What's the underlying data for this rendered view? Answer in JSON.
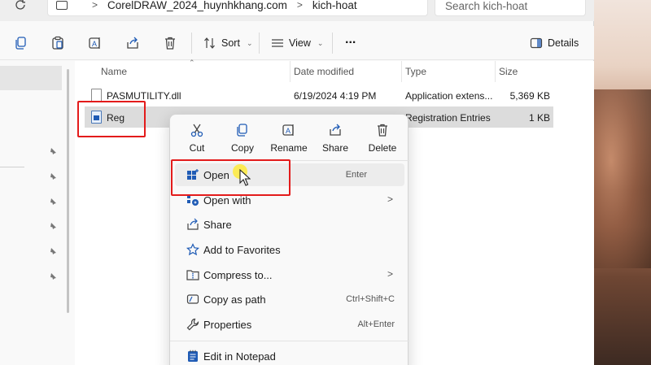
{
  "address": {
    "segments": [
      "CorelDRAW_2024_huynhkhang.com",
      "kich-hoat"
    ],
    "search_placeholder": "Search kich-hoat"
  },
  "toolbar": {
    "sort_label": "Sort",
    "view_label": "View",
    "more_label": "...",
    "details_label": "Details"
  },
  "columns": {
    "name": "Name",
    "date": "Date modified",
    "type": "Type",
    "size": "Size"
  },
  "files": [
    {
      "name": "PASMUTILITY.dll",
      "date": "6/19/2024 4:19 PM",
      "type": "Application extens...",
      "size": "5,369 KB",
      "icon": "dll-file-icon"
    },
    {
      "name": "Reg",
      "date": "",
      "type": "Registration Entries",
      "size": "1 KB",
      "icon": "reg-file-icon"
    }
  ],
  "context_menu": {
    "quick_actions": [
      {
        "label": "Cut",
        "icon": "scissors-icon"
      },
      {
        "label": "Copy",
        "icon": "copy-icon"
      },
      {
        "label": "Rename",
        "icon": "rename-icon"
      },
      {
        "label": "Share",
        "icon": "share-icon"
      },
      {
        "label": "Delete",
        "icon": "trash-icon"
      }
    ],
    "items": [
      {
        "label": "Open",
        "shortcut": "Enter",
        "icon": "open-app-icon"
      },
      {
        "label": "Open with",
        "shortcut": "",
        "icon": "open-with-icon",
        "submenu": true
      },
      {
        "label": "Share",
        "shortcut": "",
        "icon": "share-icon"
      },
      {
        "label": "Add to Favorites",
        "shortcut": "",
        "icon": "star-icon"
      },
      {
        "label": "Compress to...",
        "shortcut": "",
        "icon": "zip-folder-icon",
        "submenu": true
      },
      {
        "label": "Copy as path",
        "shortcut": "Ctrl+Shift+C",
        "icon": "path-icon"
      },
      {
        "label": "Properties",
        "shortcut": "Alt+Enter",
        "icon": "wrench-icon"
      },
      {
        "label": "Edit in Notepad",
        "shortcut": "",
        "icon": "notepad-icon"
      }
    ]
  },
  "colors": {
    "highlight": "#e31b1b",
    "accent": "#1f5bb5"
  }
}
